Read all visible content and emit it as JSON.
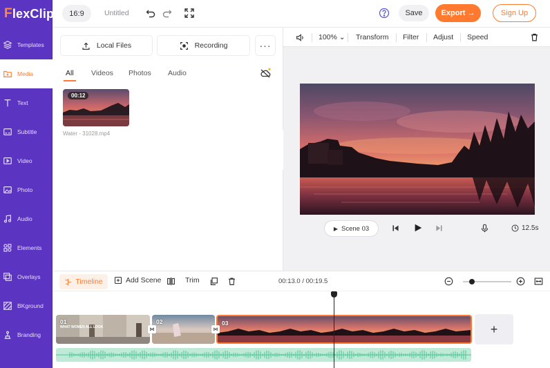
{
  "brand": {
    "logo_f": "F",
    "logo_rest": "lexClip"
  },
  "sidebar": {
    "items": [
      {
        "label": "Templates",
        "icon": "layers-icon"
      },
      {
        "label": "Media",
        "icon": "folder-icon",
        "active": true
      },
      {
        "label": "Text",
        "icon": "text-icon"
      },
      {
        "label": "Subtitle",
        "icon": "subtitle-icon"
      },
      {
        "label": "Video",
        "icon": "video-icon"
      },
      {
        "label": "Photo",
        "icon": "photo-icon"
      },
      {
        "label": "Audio",
        "icon": "music-icon"
      },
      {
        "label": "Elements",
        "icon": "elements-icon"
      },
      {
        "label": "Overlays",
        "icon": "overlays-icon"
      },
      {
        "label": "BKground",
        "icon": "background-icon"
      },
      {
        "label": "Branding",
        "icon": "branding-icon"
      }
    ]
  },
  "topbar": {
    "ratio": "16:9",
    "project_title": "Untitled",
    "save_label": "Save",
    "export_label": "Export →",
    "signup_label": "Sign Up"
  },
  "media": {
    "local_files_label": "Local Files",
    "recording_label": "Recording",
    "more_label": "···",
    "tabs": [
      "All",
      "Videos",
      "Photos",
      "Audio"
    ],
    "active_tab": "All",
    "item": {
      "duration": "00:12",
      "filename": "Water - 31028.mp4"
    }
  },
  "preview_toolbar": {
    "volume": "100%",
    "transform_label": "Transform",
    "filter_label": "Filter",
    "adjust_label": "Adjust",
    "speed_label": "Speed"
  },
  "player": {
    "scene_label": "Scene 03",
    "duration": "12.5s"
  },
  "timeline": {
    "timeline_label": "Timeline",
    "add_scene_label": "Add Scene",
    "trim_label": "Trim",
    "timecode": "00:13.0 / 00:19.5",
    "clips": [
      {
        "num": "01",
        "sub": "WHAT WOMEN ALL LOOK"
      },
      {
        "num": "02",
        "sub": ""
      },
      {
        "num": "03",
        "sub": ""
      }
    ],
    "add_label": "+"
  },
  "colors": {
    "accent": "#ff7a2f",
    "sidebar": "#5b34c2",
    "audio": "#bfead8"
  }
}
